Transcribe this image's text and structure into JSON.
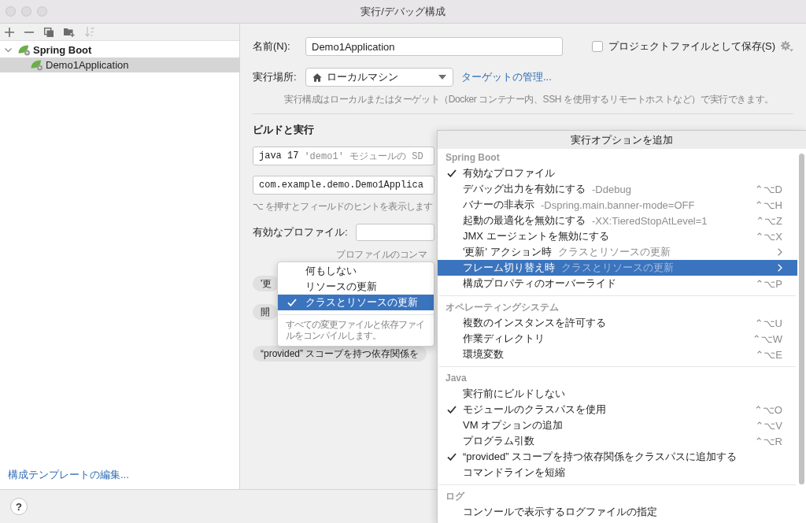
{
  "window": {
    "title": "実行/デバッグ構成"
  },
  "toolbar": [
    {
      "kind": "add",
      "disabled": false
    },
    {
      "kind": "remove",
      "disabled": false
    },
    {
      "kind": "copy",
      "disabled": false
    },
    {
      "kind": "new_folder",
      "disabled": false
    },
    {
      "kind": "sort",
      "disabled": true
    }
  ],
  "tree": [
    {
      "label": "Spring Boot",
      "expanded": true,
      "selected": false,
      "children": [
        {
          "label": "Demo1Application",
          "selected": true
        }
      ]
    }
  ],
  "sidebar_link": "構成テンプレートの編集...",
  "help_button": "?",
  "form": {
    "name_label": "名前(N):",
    "name_value": "Demo1Application",
    "save_to_project": {
      "label": "プロジェクトファイルとして保存(S)",
      "checked": false
    },
    "run_on_label": "実行場所:",
    "run_on_value": "ローカルマシン",
    "manage_targets_link": "ターゲットの管理...",
    "run_on_hint": "実行構成はローカルまたはターゲット（Docker コンテナー内、SSH を使用するリモートホストなど）で実行できます。",
    "section_title": "ビルドと実行",
    "jre": {
      "value": "java 17",
      "hint": "'demo1' モジュールの SD"
    },
    "main_class": "com.example.demo.Demo1Applica",
    "field_hint": "⌥ を押すとフィールドのヒントを表示します",
    "profiles_label": "有効なプロファイル:",
    "profiles_hint": "プロファイルのコンマ",
    "chips": [
      "'更",
      "開",
      "“provided” スコープを持つ依存関係を"
    ]
  },
  "update_dropdown": {
    "options": [
      {
        "label": "何もしない",
        "selected": false
      },
      {
        "label": "リソースの更新",
        "selected": false
      },
      {
        "label": "クラスとリソースの更新",
        "selected": true
      }
    ],
    "description": "すべての変更ファイルと依存ファイルをコンパイルします。"
  },
  "options_popup": {
    "title": "実行オプションを追加",
    "sections": [
      {
        "title": "Spring Boot",
        "items": [
          {
            "label": "有効なプロファイル",
            "checked": true,
            "selected": false,
            "submenu": false
          },
          {
            "label": "デバッグ出力を有効にする",
            "hint": "-Ddebug",
            "shortcut": "⌃⌥D",
            "checked": false,
            "selected": false,
            "submenu": false
          },
          {
            "label": "バナーの非表示",
            "hint": "-Dspring.main.banner-mode=OFF",
            "shortcut": "⌃⌥H",
            "checked": false,
            "selected": false,
            "submenu": false
          },
          {
            "label": "起動の最適化を無効にする",
            "hint": "-XX:TieredStopAtLevel=1",
            "shortcut": "⌃⌥Z",
            "checked": false,
            "selected": false,
            "submenu": false
          },
          {
            "label": "JMX エージェントを無効にする",
            "shortcut": "⌃⌥X",
            "checked": false,
            "selected": false,
            "submenu": false
          },
          {
            "label": "'更新' アクション時",
            "hint": "クラスとリソースの更新",
            "checked": false,
            "selected": false,
            "submenu": true
          },
          {
            "label": "フレーム切り替え時",
            "hint": "クラスとリソースの更新",
            "checked": false,
            "selected": true,
            "submenu": true
          },
          {
            "label": "構成プロパティのオーバーライド",
            "shortcut": "⌃⌥P",
            "checked": false,
            "selected": false,
            "submenu": false
          }
        ]
      },
      {
        "title": "オペレーティングシステム",
        "items": [
          {
            "label": "複数のインスタンスを許可する",
            "shortcut": "⌃⌥U",
            "checked": false,
            "selected": false,
            "submenu": false
          },
          {
            "label": "作業ディレクトリ",
            "shortcut": "⌃⌥W",
            "checked": false,
            "selected": false,
            "submenu": false
          },
          {
            "label": "環境変数",
            "shortcut": "⌃⌥E",
            "checked": false,
            "selected": false,
            "submenu": false
          }
        ]
      },
      {
        "title": "Java",
        "items": [
          {
            "label": "実行前にビルドしない",
            "checked": false,
            "selected": false,
            "submenu": false
          },
          {
            "label": "モジュールのクラスパスを使用",
            "shortcut": "⌃⌥O",
            "checked": true,
            "selected": false,
            "submenu": false
          },
          {
            "label": "VM オプションの追加",
            "shortcut": "⌃⌥V",
            "checked": false,
            "selected": false,
            "submenu": false
          },
          {
            "label": "プログラム引数",
            "shortcut": "⌃⌥R",
            "checked": false,
            "selected": false,
            "submenu": false
          },
          {
            "label": "“provided” スコープを持つ依存関係をクラスパスに追加する",
            "checked": true,
            "selected": false,
            "submenu": false
          },
          {
            "label": "コマンドラインを短縮",
            "checked": false,
            "selected": false,
            "submenu": false
          }
        ]
      },
      {
        "title": "ログ",
        "items": [
          {
            "label": "コンソールで表示するログファイルの指定",
            "checked": false,
            "selected": false,
            "submenu": false
          }
        ]
      }
    ]
  }
}
